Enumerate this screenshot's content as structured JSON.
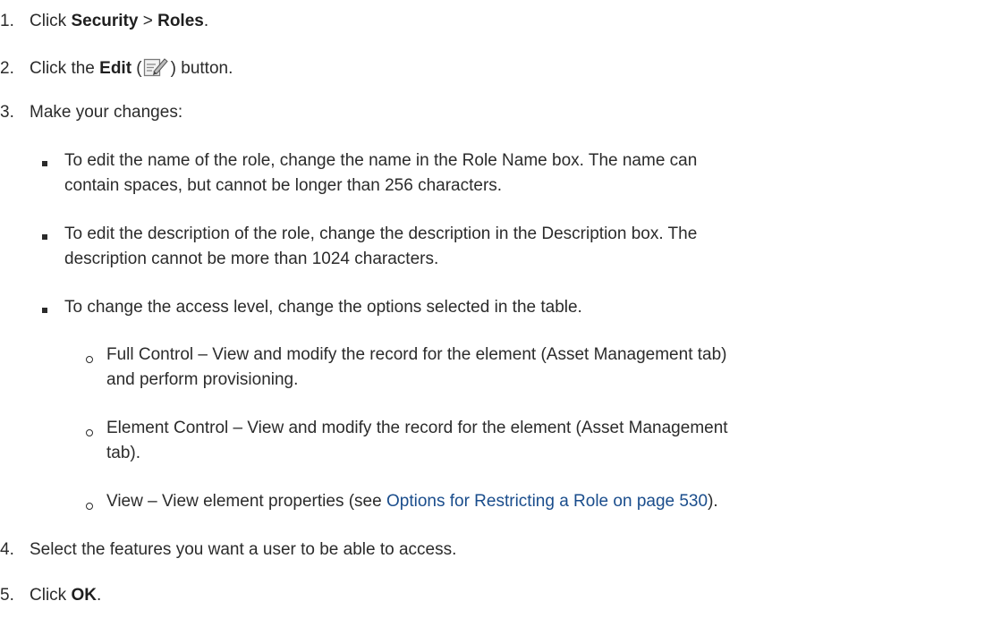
{
  "steps": [
    {
      "num": "1.",
      "pre": "Click ",
      "b1": "Security",
      "mid": " > ",
      "b2": "Roles",
      "post": "."
    },
    {
      "num": "2.",
      "pre": "Click the ",
      "b1": "Edit",
      "mid": " (",
      "post": ") button."
    },
    {
      "num": "3.",
      "text": "Make your changes:"
    },
    {
      "num": "4.",
      "text": "Select the features you want a user to be able to access."
    },
    {
      "num": "5.",
      "pre": "Click ",
      "b1": "OK",
      "post": "."
    }
  ],
  "bullets": [
    {
      "lines": [
        "To edit the name of the role, change the name in the Role Name box. The name can",
        "contain spaces, but cannot be longer than 256 characters."
      ]
    },
    {
      "lines": [
        "To edit the description of the role, change the description in the Description box. The",
        "description cannot be more than 1024 characters."
      ]
    },
    {
      "lines": [
        "To change the access level, change the options selected in the table."
      ]
    }
  ],
  "options": [
    {
      "lines": [
        "Full Control – View and modify the record for the element (Asset Management tab)",
        "and perform provisioning."
      ]
    },
    {
      "lines": [
        "Element Control – View and modify the record for the element (Asset Management",
        "tab)."
      ]
    },
    {
      "pre": "View – View element properties (see ",
      "link": "Options for Restricting a Role on page 530",
      "post": ")."
    }
  ],
  "icons": {
    "edit": "edit-pencil-icon"
  }
}
